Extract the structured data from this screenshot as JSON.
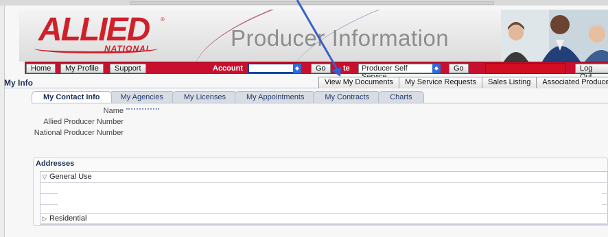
{
  "banner": {
    "logo_main": "ALLIED",
    "logo_sub": "NATIONAL",
    "logo_reg": "®",
    "title": "Producer Information"
  },
  "nav": {
    "home": "Home",
    "my_profile": "My Profile",
    "support": "Support",
    "account_label": "Account",
    "account_value": "",
    "go1": "Go",
    "site_label": "te",
    "site_select": "Producer Self Service",
    "go2": "Go",
    "logout": "Log Out"
  },
  "page": {
    "title": "My Info"
  },
  "subnav": [
    "View My Documents",
    "My Service Requests",
    "Sales Listing",
    "Associated Producers"
  ],
  "tabs": [
    "My Contact Info",
    "My Agencies",
    "My Licenses",
    "My Appointments",
    "My Contracts",
    "Charts"
  ],
  "fields": {
    "name": "Name",
    "allied_number": "Allied Producer Number",
    "national_number": "National Producer Number"
  },
  "addresses": {
    "title": "Addresses",
    "general_use": "General Use",
    "residential": "Residential",
    "expanded_icon": "▽",
    "collapsed_icon": "▷"
  },
  "colors": {
    "brand_red": "#c8102e",
    "accent_blue": "#2f6bd8",
    "title_navy": "#1c2f55"
  }
}
